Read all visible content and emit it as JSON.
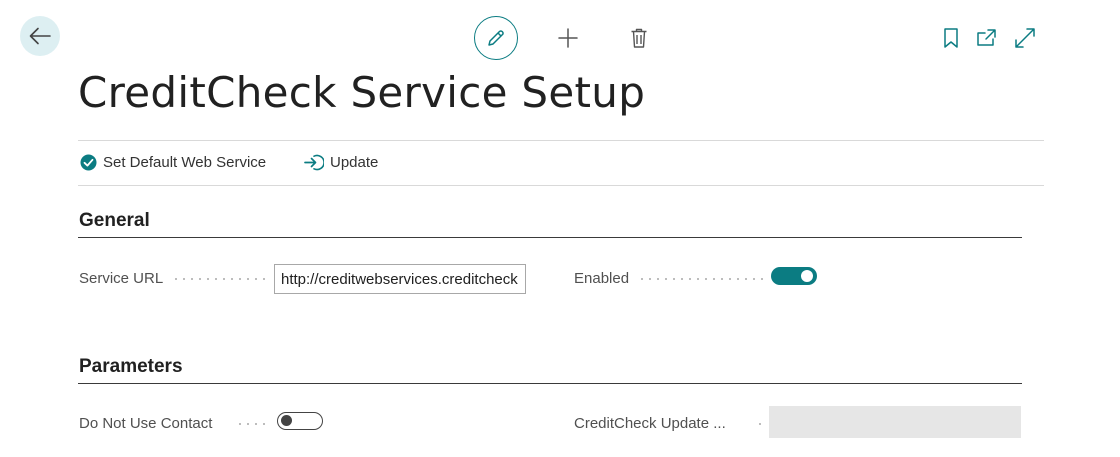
{
  "page": {
    "title": "CreditCheck Service Setup"
  },
  "actions": [
    {
      "label": "Set Default Web Service",
      "icon": "check-circle-icon"
    },
    {
      "label": "Update",
      "icon": "arrow-into-icon"
    }
  ],
  "sections": {
    "general": {
      "title": "General",
      "service_url_label": "Service URL",
      "service_url_value": "http://creditwebservices.creditcheck",
      "enabled_label": "Enabled",
      "enabled": true
    },
    "parameters": {
      "title": "Parameters",
      "do_not_use_contact_label": "Do Not Use Contact",
      "do_not_use_contact": false,
      "creditcheck_update_label": "CreditCheck Update ...",
      "creditcheck_update_value": ""
    }
  },
  "colors": {
    "accent": "#0b7c82",
    "back_bg": "#ddeff2"
  }
}
